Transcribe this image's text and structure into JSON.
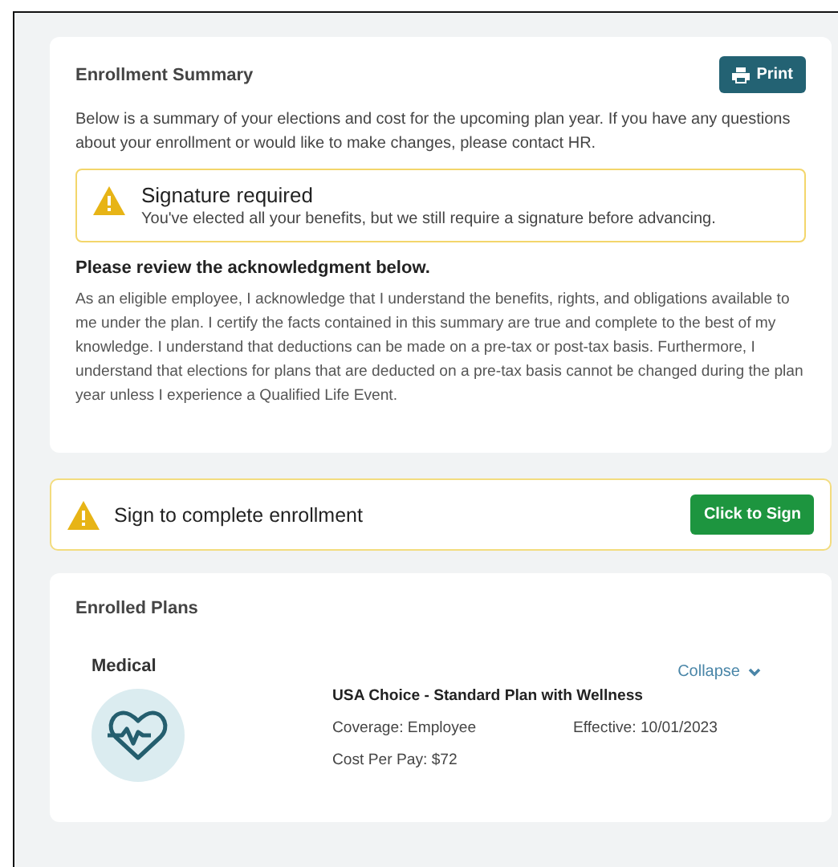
{
  "summary": {
    "title": "Enrollment Summary",
    "print_button": "Print",
    "intro": "Below is a summary of your elections and cost for the upcoming plan year. If you have any questions about your enrollment or would like to make changes, please contact HR.",
    "alert": {
      "title": "Signature required",
      "message": "You've elected all your benefits, but we still require a signature before advancing."
    },
    "ack_heading": "Please review the acknowledgment below.",
    "ack_text": "As an eligible employee, I acknowledge that I understand the benefits, rights, and obligations available to me under the plan.  I certify the facts contained in this summary are true and complete to the best of my knowledge.  I understand that deductions can be made on a pre-tax or post-tax basis.   Furthermore, I understand that elections for plans that are deducted on a pre-tax basis cannot be changed during the plan year unless I experience a Qualified Life Event."
  },
  "sign_bar": {
    "text": "Sign to complete enrollment",
    "button": "Click to Sign"
  },
  "enrolled": {
    "title": "Enrolled Plans",
    "plans": [
      {
        "category": "Medical",
        "toggle": "Collapse",
        "expanded": true,
        "name": "USA Choice - Standard Plan with Wellness",
        "coverage": "Coverage: Employee",
        "effective": "Effective: 10/01/2023",
        "cost": "Cost Per Pay: $72"
      }
    ]
  }
}
